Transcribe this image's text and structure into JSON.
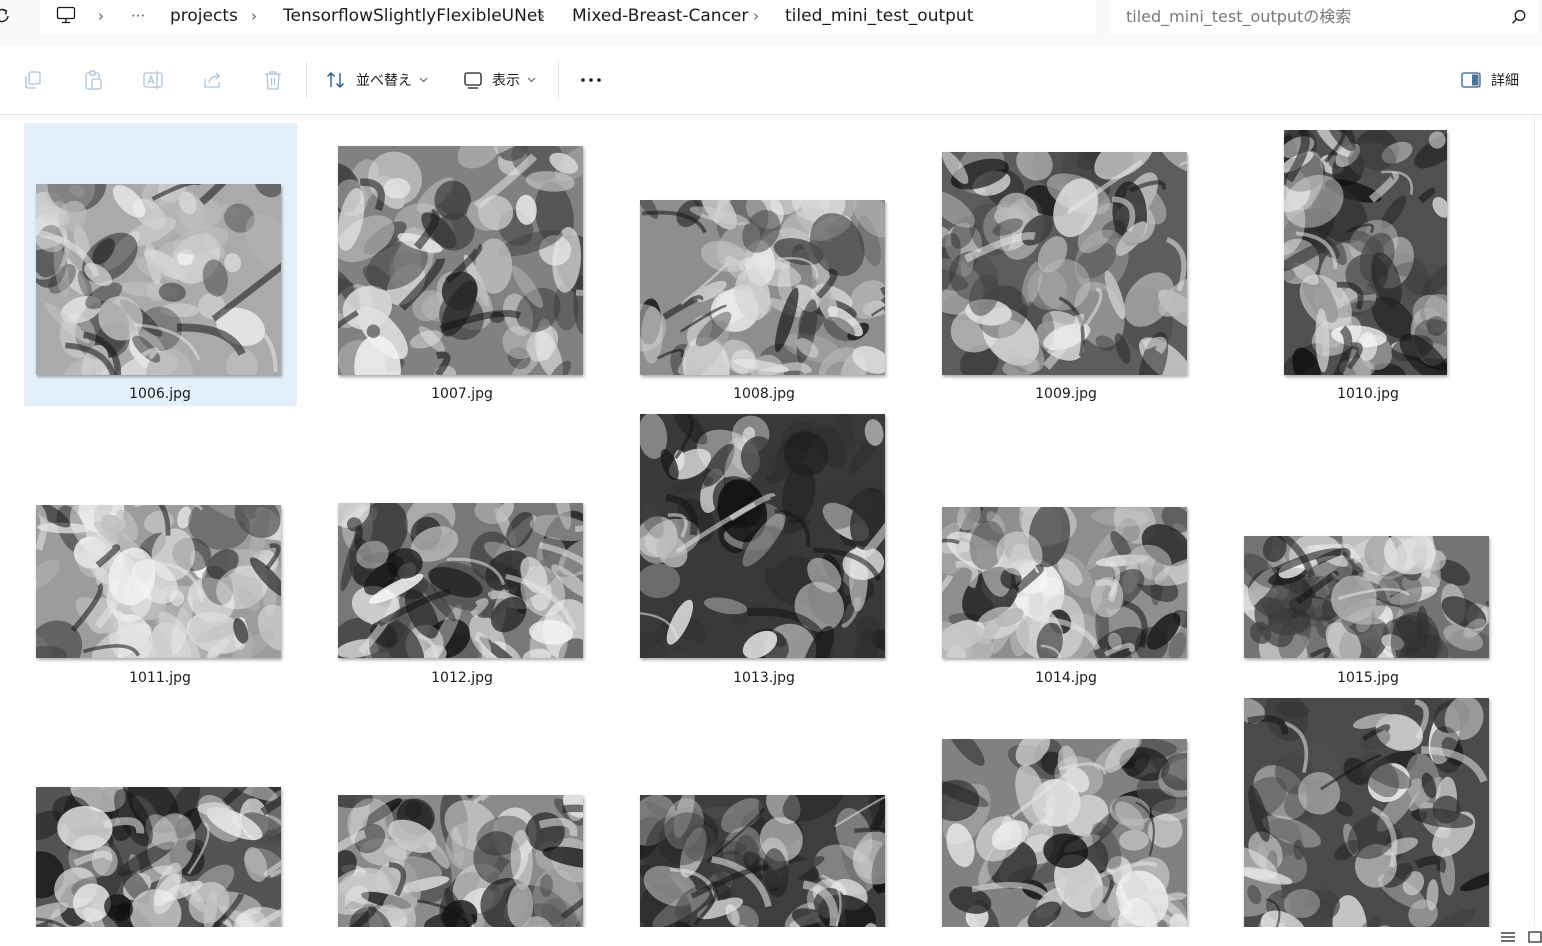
{
  "breadcrumb": {
    "more_label": "···",
    "items": [
      "projects",
      "TensorflowSlightlyFlexibleUNet",
      "Mixed-Breast-Cancer",
      "tiled_mini_test_output"
    ],
    "separator": "›"
  },
  "search": {
    "placeholder": "tiled_mini_test_outputの検索"
  },
  "commands": {
    "sort_label": "並べ替え",
    "view_label": "表示",
    "more_label": "···",
    "details_label": "詳細"
  },
  "files": [
    {
      "name": "1006.jpg",
      "selected": true
    },
    {
      "name": "1007.jpg"
    },
    {
      "name": "1008.jpg"
    },
    {
      "name": "1009.jpg"
    },
    {
      "name": "1010.jpg"
    },
    {
      "name": "1011.jpg"
    },
    {
      "name": "1012.jpg"
    },
    {
      "name": "1013.jpg"
    },
    {
      "name": "1014.jpg"
    },
    {
      "name": "1015.jpg"
    },
    {
      "name": ""
    },
    {
      "name": ""
    },
    {
      "name": ""
    },
    {
      "name": ""
    },
    {
      "name": ""
    }
  ],
  "colors": {
    "selection": "#e3f0fc",
    "accent": "#0067c0"
  }
}
